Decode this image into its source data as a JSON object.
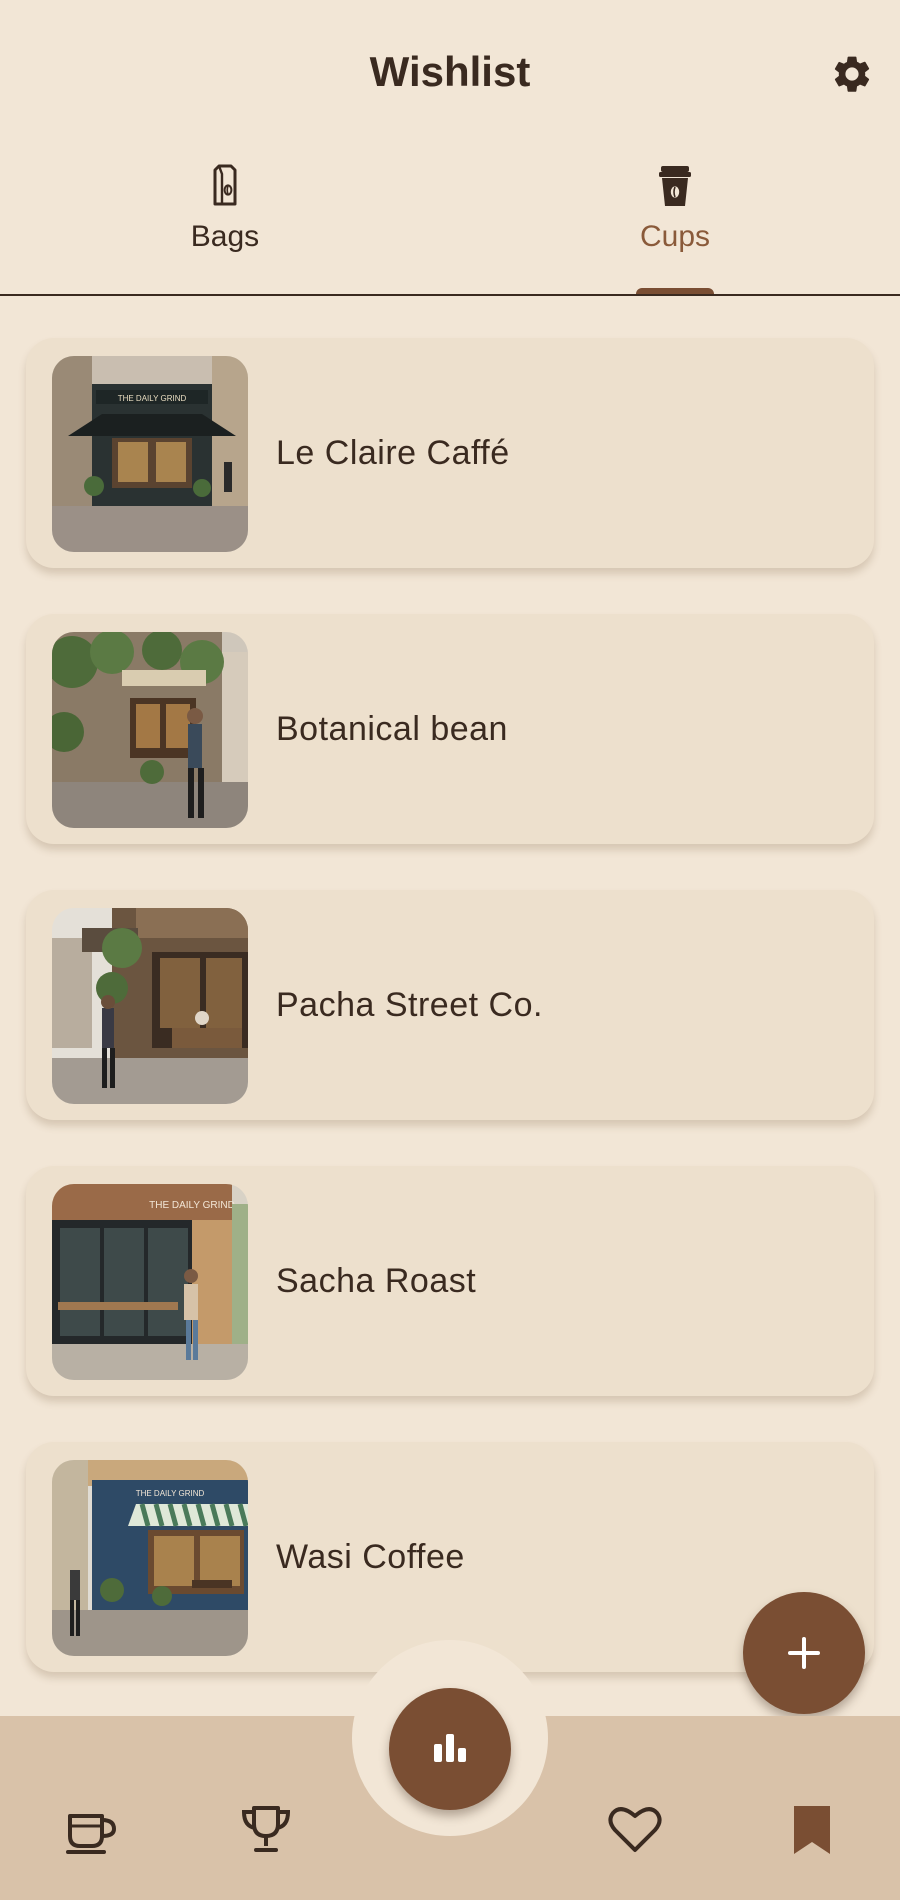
{
  "header": {
    "title": "Wishlist"
  },
  "tabs": [
    {
      "label": "Bags",
      "icon": "coffee-bag-icon",
      "selected": false
    },
    {
      "label": "Cups",
      "icon": "coffee-cup-icon",
      "selected": true
    }
  ],
  "cafes": [
    {
      "name": "Le Claire Caffé",
      "sign": "THE DAILY GRIND"
    },
    {
      "name": "Botanical bean",
      "sign": ""
    },
    {
      "name": "Pacha Street Co.",
      "sign": ""
    },
    {
      "name": "Sacha Roast",
      "sign": "THE DAILY GRIND"
    },
    {
      "name": "Wasi Coffee",
      "sign": "THE DAILY GRIND"
    }
  ],
  "bottom_nav": [
    {
      "icon": "coffee-mug-icon"
    },
    {
      "icon": "trophy-icon"
    },
    {
      "icon": "bar-chart-icon"
    },
    {
      "icon": "heart-icon"
    },
    {
      "icon": "bookmark-icon"
    }
  ],
  "colors": {
    "background": "#f2e6d6",
    "card": "#ede0cd",
    "accent": "#7a4e33",
    "nav_bar": "#d9c2a9",
    "text": "#3a2a20"
  }
}
